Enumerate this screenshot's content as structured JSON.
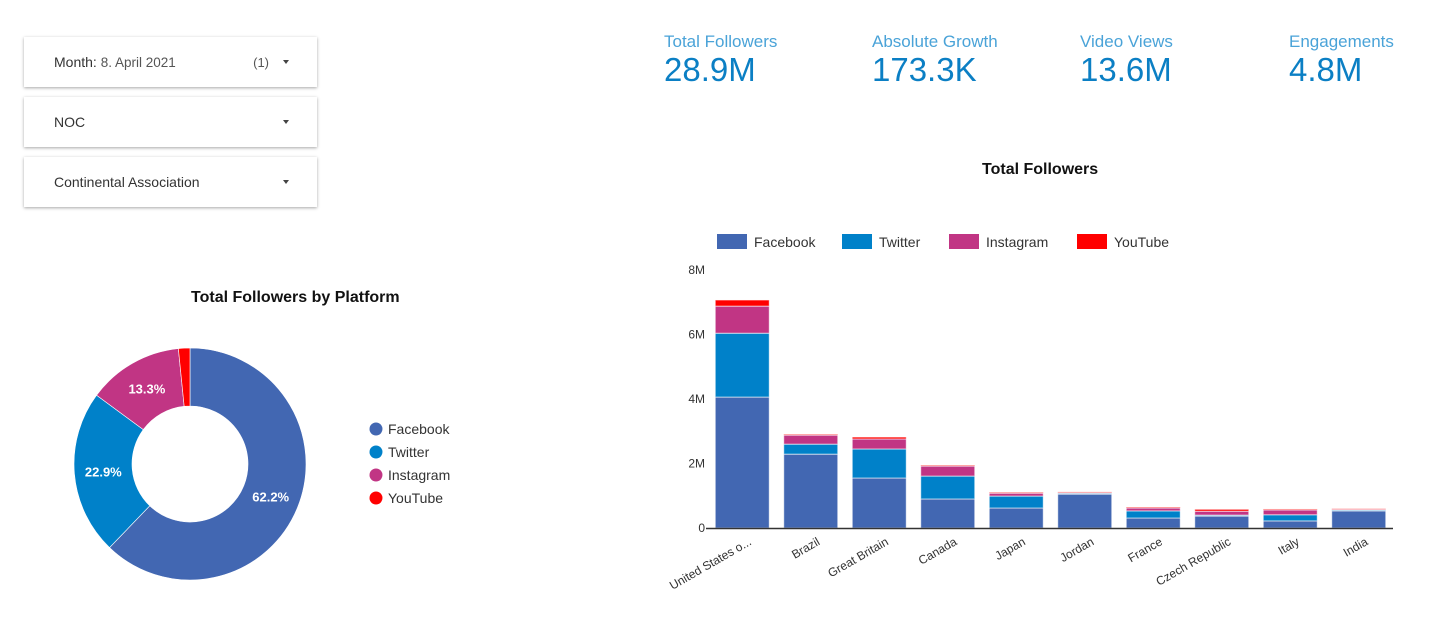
{
  "filters": [
    {
      "label": "Month",
      "value": "8. April 2021",
      "count": "(1)"
    },
    {
      "label": "NOC",
      "value": "",
      "count": ""
    },
    {
      "label": "Continental Association",
      "value": "",
      "count": ""
    }
  ],
  "kpis": [
    {
      "label": "Total Followers",
      "value": "28.9M"
    },
    {
      "label": "Absolute Growth",
      "value": "173.3K"
    },
    {
      "label": "Video Views",
      "value": "13.6M"
    },
    {
      "label": "Engagements",
      "value": "4.8M"
    }
  ],
  "colors": {
    "Facebook": "#4267b2",
    "Twitter": "#0081c9",
    "Instagram": "#c13584",
    "YouTube": "#ff0000"
  },
  "chart_data": [
    {
      "type": "pie",
      "title": "Total Followers by Platform",
      "donut": true,
      "categories": [
        "Facebook",
        "Twitter",
        "Instagram",
        "YouTube"
      ],
      "values": [
        62.2,
        22.9,
        13.3,
        1.6
      ],
      "labels": [
        "62.2%",
        "22.9%",
        "13.3%",
        ""
      ],
      "legend": "right"
    },
    {
      "type": "bar",
      "stacked": true,
      "title": "Total Followers",
      "categories": [
        "United States o...",
        "Brazil",
        "Great Britain",
        "Canada",
        "Japan",
        "Jordan",
        "France",
        "Czech Republic",
        "Italy",
        "India"
      ],
      "series": [
        {
          "name": "Facebook",
          "values": [
            4.06,
            2.29,
            1.55,
            0.9,
            0.62,
            1.05,
            0.31,
            0.37,
            0.22,
            0.53
          ]
        },
        {
          "name": "Twitter",
          "values": [
            1.98,
            0.31,
            0.9,
            0.71,
            0.37,
            0.03,
            0.22,
            0.03,
            0.19,
            0.03
          ]
        },
        {
          "name": "Instagram",
          "values": [
            0.84,
            0.28,
            0.31,
            0.31,
            0.09,
            0.03,
            0.09,
            0.12,
            0.15,
            0.03
          ]
        },
        {
          "name": "YouTube",
          "values": [
            0.19,
            0.03,
            0.06,
            0.03,
            0.03,
            0.01,
            0.03,
            0.06,
            0.03,
            0.01
          ]
        }
      ],
      "unit": "M",
      "ylim": [
        0,
        8
      ],
      "yticks": [
        0,
        2,
        4,
        6,
        8
      ],
      "ytick_labels": [
        "0",
        "2M",
        "4M",
        "6M",
        "8M"
      ],
      "xlabel": "",
      "ylabel": "",
      "grid": false,
      "legend": "top"
    }
  ]
}
